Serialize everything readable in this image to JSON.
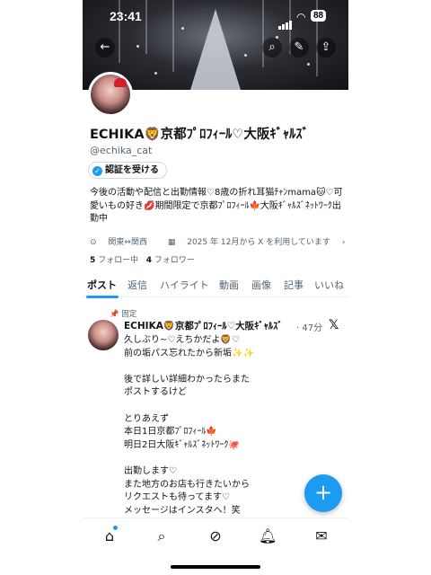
{
  "status_bar": {
    "time": "23:41",
    "battery": "88"
  },
  "nav": {
    "back_icon": "arrow-left-icon",
    "search_icon": "search-icon",
    "edit_icon": "edit-icon",
    "share_icon": "share-icon"
  },
  "profile": {
    "name": "ECHIKA🦁京都ﾌﾟﾛﾌｨｰﾙ♡大阪ｷﾞｬﾙｽﾞ",
    "handle": "@echika_cat",
    "verify_button": "認証を受ける",
    "bio": "今後の活動や配信と出勤情報♡8歳の折れ耳猫ﾁｬﾝmama🐱♡可愛いもの好き💋期間限定で京都ﾌﾟﾛﾌｨｰﾙ🍁大阪ｷﾞｬﾙｽﾞﾈｯﾄﾜｰｸ出勤中",
    "location": "関東⇔関西",
    "joined": "2025 年 12月から X を利用しています",
    "following_count": "5",
    "following_label": "フォロー中",
    "followers_count": "4",
    "followers_label": "フォロワー"
  },
  "tabs": [
    {
      "label": "ポスト",
      "active": true
    },
    {
      "label": "返信"
    },
    {
      "label": "ハイライト"
    },
    {
      "label": "動画"
    },
    {
      "label": "画像"
    },
    {
      "label": "記事"
    },
    {
      "label": "いいね"
    }
  ],
  "pinned_post": {
    "pinned_label": "固定",
    "author": "ECHIKA🦁京都ﾌﾟﾛﾌｨｰﾙ♡大阪ｷﾞｬﾙｽﾞ",
    "time": "· 47分",
    "text": "久しぶり~♡えちかだよ🦁♡\n前の垢パス忘れたから新垢✨✨\n\n後で詳しい詳細わかったらまた\nポストするけど\n\nとりあえず\n本日1日京都ﾌﾟﾛﾌｨｰﾙ🍁\n明日2日大阪ｷﾞｬﾙｽﾞﾈｯﾄﾜｰｸ🐙\n\n出勤します♡\nまた地方のお店も行きたいから\nリクエストも待ってます♡\nメッセージはインスタへ！笑"
  },
  "fab": {
    "label": "+"
  },
  "accent_color": "#1d9bf0"
}
